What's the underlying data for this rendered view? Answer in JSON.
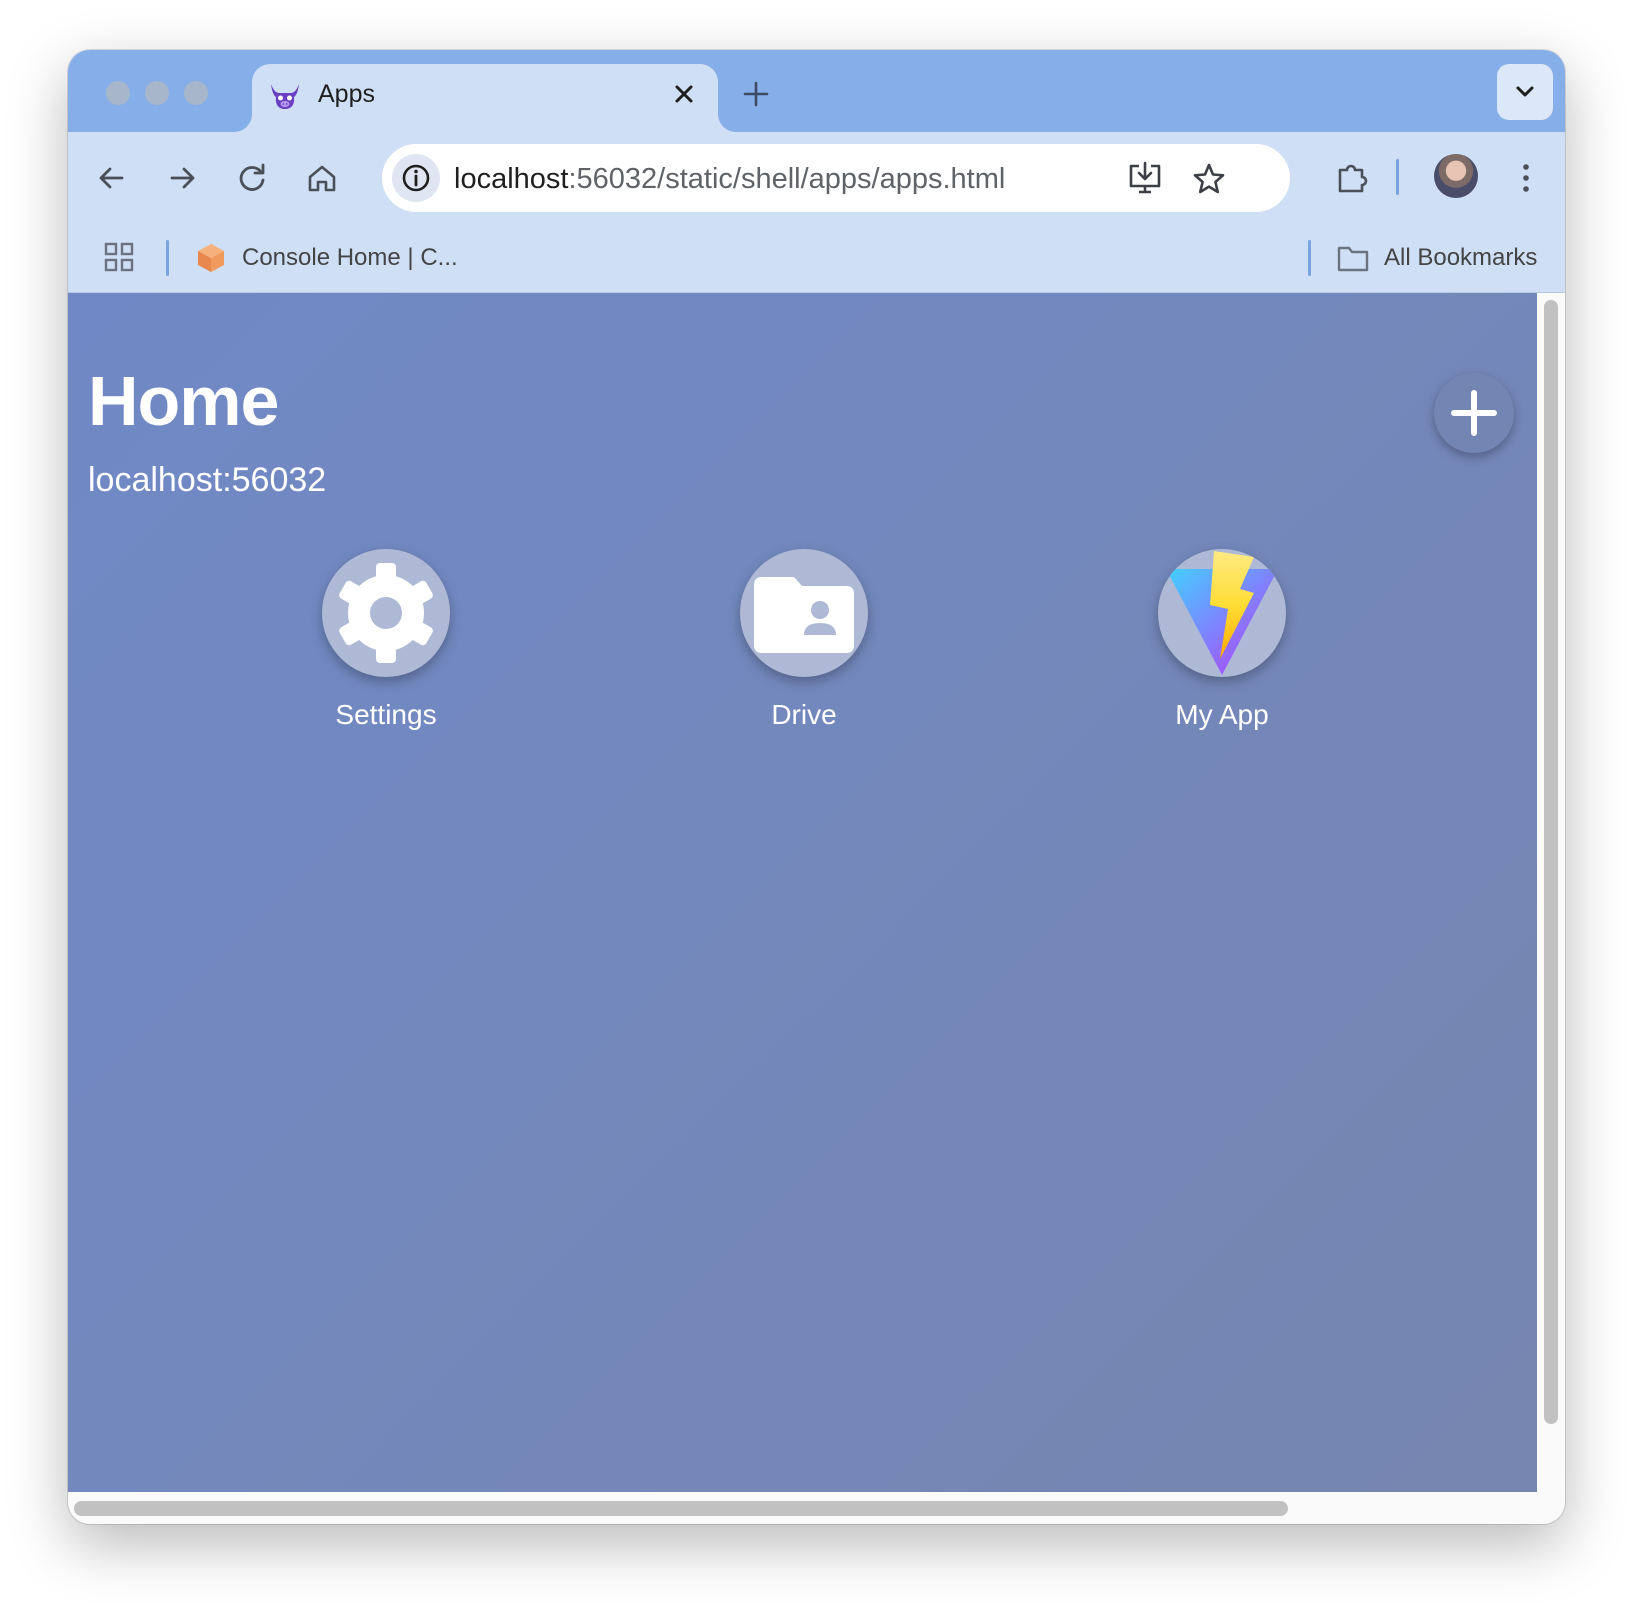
{
  "window": {
    "tab": {
      "title": "Apps",
      "favicon": "purple-bull-logo-icon",
      "close_icon": "close-icon"
    },
    "new_tab_icon": "plus-icon",
    "tab_list_icon": "chevron-down-icon"
  },
  "toolbar": {
    "back_icon": "arrow-left-icon",
    "forward_icon": "arrow-right-icon",
    "reload_icon": "reload-icon",
    "home_icon": "home-icon",
    "url_host": "localhost",
    "url_rest": ":56032/static/shell/apps/apps.html",
    "site_info_icon": "info-icon",
    "install_icon": "install-app-icon",
    "bookmark_icon": "star-icon",
    "extensions_icon": "puzzle-icon",
    "menu_icon": "kebab-menu-icon"
  },
  "bookmarks": {
    "apps_icon": "grid-icon",
    "items": [
      {
        "label": "Console Home | C...",
        "icon": "orange-cube-icon"
      }
    ],
    "all_bookmarks_label": "All Bookmarks",
    "folder_icon": "folder-icon"
  },
  "page": {
    "title": "Home",
    "host": "localhost:56032",
    "add_icon": "plus-icon",
    "apps": [
      {
        "label": "Settings",
        "icon": "gear-icon"
      },
      {
        "label": "Drive",
        "icon": "folder-user-icon"
      },
      {
        "label": "My App",
        "icon": "vite-logo-icon"
      }
    ]
  },
  "colors": {
    "tabstrip": "#86aee9",
    "toolbar": "#cfdff6",
    "content_start": "#7089c6",
    "content_end": "#7786b0"
  }
}
